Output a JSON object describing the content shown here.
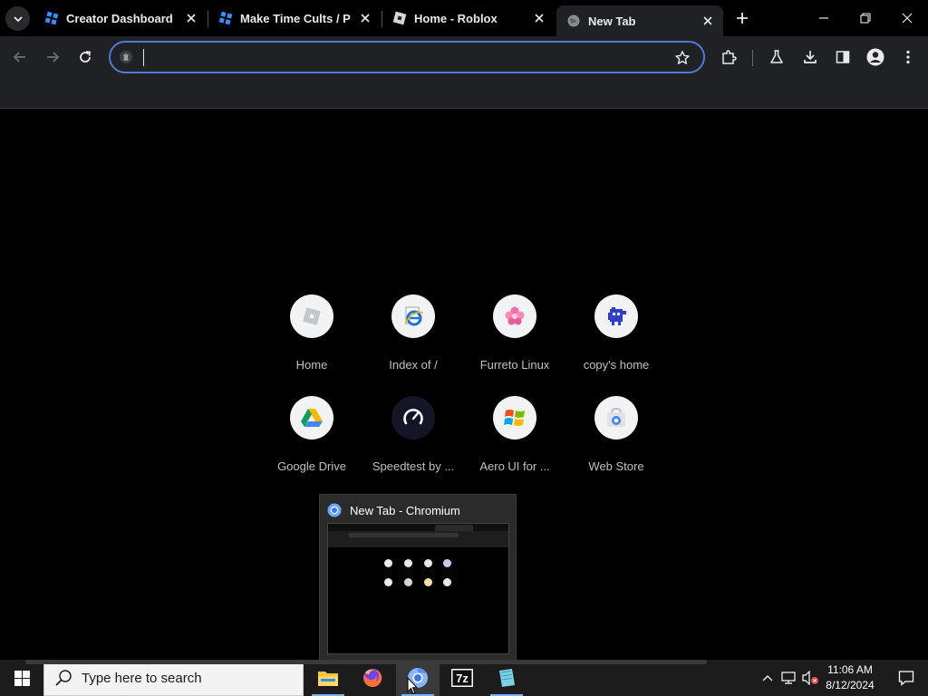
{
  "browser": {
    "tabs": [
      {
        "title": "Creator Dashboard",
        "favicon": "roblox-studio-icon",
        "active": false
      },
      {
        "title": "Make Time Cults / Per",
        "favicon": "roblox-studio-icon",
        "active": false
      },
      {
        "title": "Home - Roblox",
        "favicon": "roblox-icon",
        "active": false
      },
      {
        "title": "New Tab",
        "favicon": "globe-icon",
        "active": true
      }
    ],
    "omnibox": {
      "value": "",
      "placeholder": ""
    },
    "accent_color": "#4e7ad6"
  },
  "ntp": {
    "shortcuts": [
      {
        "label": "Home",
        "icon": "roblox-home-icon"
      },
      {
        "label": "Index of /",
        "icon": "internet-explorer-icon"
      },
      {
        "label": "Furreto Linux",
        "icon": "pink-flower-icon"
      },
      {
        "label": "copy's home",
        "icon": "pixel-creature-icon"
      },
      {
        "label": "Google Drive",
        "icon": "google-drive-icon"
      },
      {
        "label": "Speedtest by ...",
        "icon": "speedtest-icon"
      },
      {
        "label": "Aero UI for ...",
        "icon": "windows-xp-logo-icon"
      },
      {
        "label": "Web Store",
        "icon": "web-store-icon"
      }
    ]
  },
  "preview": {
    "title": "New Tab - Chromium"
  },
  "taskbar": {
    "search_placeholder": "Type here to search",
    "apps": [
      {
        "name": "File Explorer",
        "icon": "folder-icon"
      },
      {
        "name": "Firefox",
        "icon": "firefox-icon"
      },
      {
        "name": "Chromium",
        "icon": "chromium-icon"
      },
      {
        "name": "7-Zip",
        "icon": "7zip-icon"
      },
      {
        "name": "Notepad",
        "icon": "notepad-icon"
      }
    ],
    "clock": {
      "time": "11:06 AM",
      "date": "8/12/2024"
    }
  }
}
